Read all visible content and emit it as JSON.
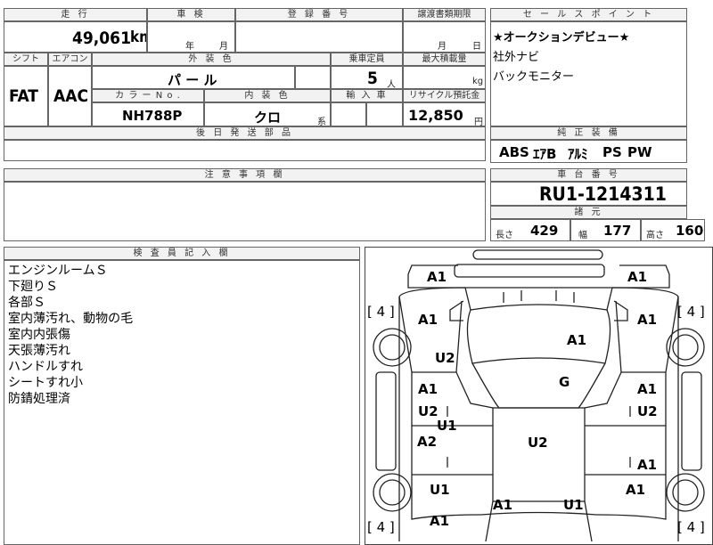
{
  "header": {
    "mileage_label": "走 行",
    "mileage_value": "49,061",
    "mileage_unit": "km",
    "inspection_label": "車 検",
    "year_label": "年",
    "month_label": "月",
    "registration_label": "登 録 番 号",
    "transfer_label": "譲渡書類期限",
    "transfer_month": "月",
    "transfer_day": "日"
  },
  "specs": {
    "shift_label": "シフト",
    "shift_value": "FAT",
    "ac_label": "エアコン",
    "ac_value": "AAC",
    "exterior_label": "外 装 色",
    "exterior_value": "パ ー ル",
    "capacity_label": "乗車定員",
    "capacity_value": "5",
    "capacity_unit": "人",
    "load_label": "最大積載量",
    "load_unit": "kg",
    "color_no_label": "カ ラ ー N o .",
    "color_no_value": "NH788P",
    "interior_label": "内 装 色",
    "interior_value": "クロ",
    "interior_unit": "系",
    "import_label": "輸 入 車",
    "recycle_label": "リサイクル預託金",
    "recycle_value": "12,850",
    "recycle_unit": "円"
  },
  "later_parts_label": "後 日 発 送 部 品",
  "sales_points": {
    "label": "セ ー ル ス ポ イ ン ト",
    "items": [
      "★オークションデビュー★",
      "社外ナビ",
      "バックモニター"
    ]
  },
  "equipment": {
    "label": "純 正 装 備",
    "items": [
      "ABS",
      "ｴｱB",
      "ｱﾙﾐ",
      "PS",
      "PW"
    ]
  },
  "notes_label": "注 意 事 項 欄",
  "chassis": {
    "label": "車 台 番 号",
    "value": "RU1-1214311"
  },
  "dims": {
    "label": "諸 元",
    "length_label": "長さ",
    "length_value": "429",
    "width_label": "幅",
    "width_value": "177",
    "height_label": "高さ",
    "height_value": "160"
  },
  "inspector": {
    "label": "検 査 員 記 入 欄",
    "items": [
      "エンジンルームＳ",
      "下廻りＳ",
      "各部Ｓ",
      "室内薄汚れ、動物の毛",
      "室内内張傷",
      "天張薄汚れ",
      "ハンドルすれ",
      "シートすれ小",
      "防錆処理済"
    ]
  },
  "diagram": {
    "tire_marks": [
      "[ 4 ]",
      "[ 4 ]",
      "[ 4 ]",
      "[ 4 ]"
    ],
    "marks": [
      "A1",
      "A1",
      "A1",
      "A1",
      "A1",
      "U2",
      "G",
      "A1",
      "A1",
      "U2",
      "U2",
      "U1",
      "A2",
      "U2",
      "A1",
      "U1",
      "A1",
      "A1",
      "U1",
      "A1"
    ]
  }
}
